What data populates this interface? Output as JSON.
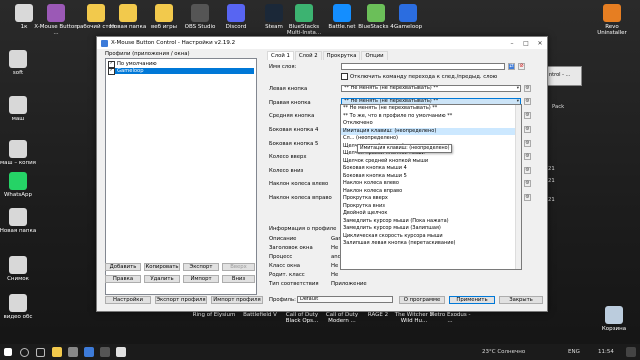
{
  "desktop": {
    "icons": [
      {
        "label": "1к",
        "color": "#d9d9d9"
      },
      {
        "label": "X-Mouse Button ...",
        "color": "#9b59b6"
      },
      {
        "label": "рабочий стол",
        "color": "#f2c94c"
      },
      {
        "label": "Новая папка",
        "color": "#f2c94c"
      },
      {
        "label": "веб игры",
        "color": "#f2c94c"
      },
      {
        "label": "OBS Studio",
        "color": "#555"
      },
      {
        "label": "Discord",
        "color": "#5865f2"
      },
      {
        "label": "Steam",
        "color": "#1b2838"
      },
      {
        "label": "BlueStacks Multi-Insta...",
        "color": "#3cb371"
      },
      {
        "label": "Battle.net",
        "color": "#148eff"
      },
      {
        "label": "BlueStacks 4",
        "color": "#6bbf59"
      },
      {
        "label": "Gameloop",
        "color": "#2b6de0"
      },
      {
        "label": "Revo Uninstaller",
        "color": "#e67e22"
      }
    ],
    "left_icons": [
      {
        "label": "soft"
      },
      {
        "label": "маш"
      },
      {
        "label": "маш – копия"
      },
      {
        "label": "WhatsApp"
      },
      {
        "label": "Новая папка"
      },
      {
        "label": "Снимок"
      },
      {
        "label": "видео обс"
      }
    ],
    "bottom_icons": [
      {
        "label": "Ring of Elysium"
      },
      {
        "label": "Battlefield V"
      },
      {
        "label": "Call of Duty Black Ops..."
      },
      {
        "label": "Call of Duty Modern ..."
      },
      {
        "label": "RAGE 2"
      },
      {
        "label": "The Witcher 3 Wild Hu..."
      },
      {
        "label": "Metro Exodus - ..."
      }
    ],
    "recycle_bin": "Корзина"
  },
  "window": {
    "title": "X-Mouse Button Control - Настройки v2.19.2",
    "profiles_header": "Профили (приложения / окна)",
    "profiles": [
      {
        "label": "По умолчанию",
        "checked": true,
        "selected": false
      },
      {
        "label": "Gameloop",
        "checked": true,
        "selected": true
      }
    ],
    "profile_buttons": [
      "Добавить",
      "Копировать",
      "Экспорт",
      "Вверх",
      "Правка",
      "Удалить",
      "Импорт",
      "Вниз"
    ],
    "tabs": [
      "Слой 1",
      "Слой 2",
      "Прокрутка",
      "Опции"
    ],
    "layer_name_label": "Имя слоя:",
    "no_switch_checkbox": "Отключить команду перехода к след./предыд. слою",
    "rows": [
      {
        "label": "Левая кнопка",
        "value": "** Не менять (не перехватывать) **"
      },
      {
        "label": "Правая кнопка",
        "value": "** Не менять (не перехватывать) **"
      },
      {
        "label": "Средняя кнопка",
        "value": ""
      },
      {
        "label": "Боковая кнопка 4",
        "value": ""
      },
      {
        "label": "Боковая кнопка 5",
        "value": ""
      },
      {
        "label": "Колесо вверх",
        "value": ""
      },
      {
        "label": "Колесо вниз",
        "value": ""
      },
      {
        "label": "Наклон колеса влево",
        "value": ""
      },
      {
        "label": "Наклон колеса вправо",
        "value": ""
      }
    ],
    "dropdown_items": [
      "** Не менять (не перехватывать) **",
      "** То же, что в профиле по умолчанию **",
      "Отключено",
      "Имитация клавиш: (неопределено)",
      "Cл... (неопределено)",
      "Щелчок левой кнопкой мыши",
      "Щелчок правой кнопкой мыши",
      "Щелчок средней кнопкой мыши",
      "Боковая кнопка мыши 4",
      "Боковая кнопка мыши 5",
      "Наклон колеса влево",
      "Наклон колеса вправо",
      "Прокрутка вверх",
      "Прокрутка вниз",
      "Двойной щелчок",
      "Замедлить курсор мыши (Пока нажата)",
      "Замедлить курсор мыши (Залипшая)",
      "Циклическая скорость курсора мыши",
      "Залипшая левая кнопка (перетаскивание)"
    ],
    "dropdown_highlight_index": 3,
    "tooltip": "Имитация клавиш: (неопределено)",
    "profile_info": {
      "header": "Информация о профиле",
      "fields": [
        {
          "label": "Описание",
          "value": "Game"
        },
        {
          "label": "Заголовок окна",
          "value": "Не"
        },
        {
          "label": "Процесс",
          "value": "and"
        },
        {
          "label": "Класс окна",
          "value": "Не"
        },
        {
          "label": "Родит. класс",
          "value": "Не"
        },
        {
          "label": "Тип соответствия",
          "value": "Приложение"
        }
      ]
    },
    "footer": {
      "settings": "Настройки",
      "export_profile": "Экспорт профиля",
      "import_profile": "Импорт профиля",
      "profile_label": "Профиль:",
      "profile_value": "Default",
      "about": "О программе",
      "apply": "Применить",
      "close": "Закрыть"
    }
  },
  "right_panel_fragment": "ntrol - ...",
  "right_side_text": [
    "Pack",
    "21",
    "21",
    "21"
  ],
  "taskbar": {
    "weather": "23°C Солнечно",
    "lang": "ENG",
    "time": "11:54"
  }
}
